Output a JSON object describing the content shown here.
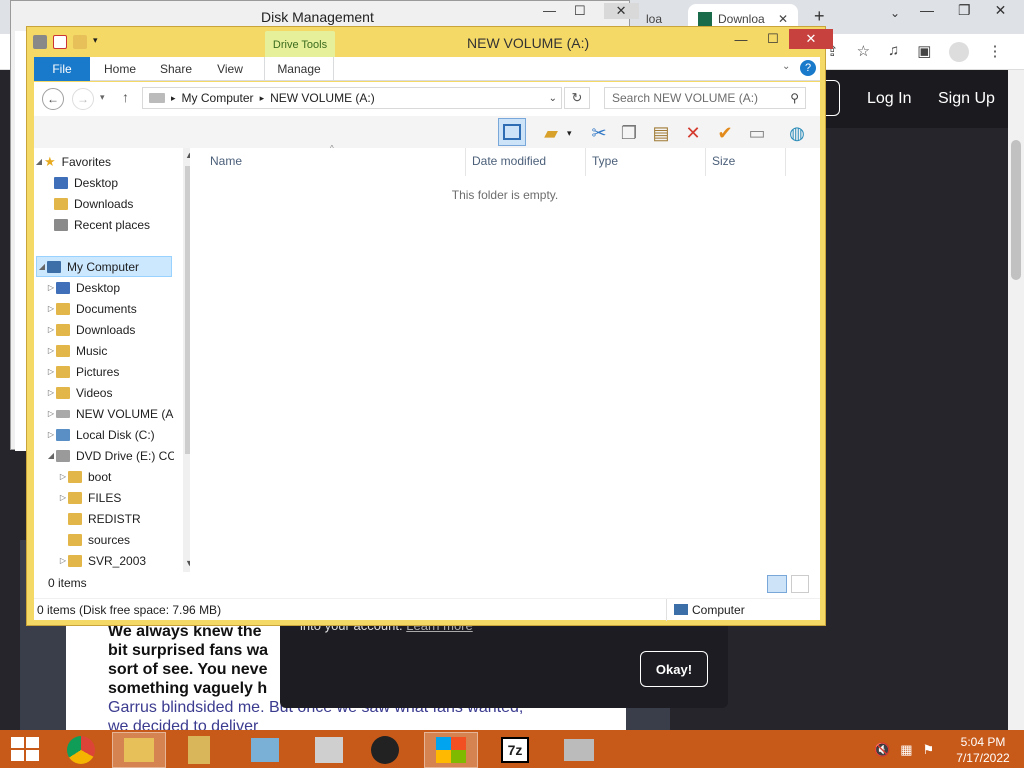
{
  "browser": {
    "tabs": [
      {
        "label": "loa"
      },
      {
        "label": "Downloa"
      }
    ],
    "new_tab": "+",
    "nav": {
      "login": "Log In",
      "signup": "Sign Up"
    },
    "article_lines": [
      "We always knew the",
      "bit surprised fans wa",
      "sort of see. You neve",
      "something vaguely h"
    ],
    "article_blue": "Garrus blindsided me. But once we saw what fans wanted,",
    "article_tail": "we decided to deliver",
    "popup": {
      "text": "into your account.",
      "link": "Learn more",
      "ok": "Okay!"
    }
  },
  "disk_management": {
    "title": "Disk Management"
  },
  "explorer": {
    "title": "NEW VOLUME (A:)",
    "drive_tools": "Drive Tools",
    "ribbon_tabs": [
      "File",
      "Home",
      "Share",
      "View",
      "Manage"
    ],
    "address": {
      "root": "My Computer",
      "current": "NEW VOLUME (A:)"
    },
    "search_placeholder": "Search NEW VOLUME (A:)",
    "tree": {
      "favorites": "Favorites",
      "fav_items": [
        "Desktop",
        "Downloads",
        "Recent places"
      ],
      "computer": "My Computer",
      "computer_items": [
        "Desktop",
        "Documents",
        "Downloads",
        "Music",
        "Pictures",
        "Videos",
        "NEW VOLUME (A:)",
        "Local Disk (C:)",
        "DVD Drive (E:) CC"
      ],
      "dvd_items": [
        "boot",
        "FILES",
        "REDISTR",
        "sources",
        "SVR_2003"
      ]
    },
    "columns": [
      "Name",
      "Date modified",
      "Type",
      "Size"
    ],
    "empty_text": "This folder is empty.",
    "item_count": "0 items",
    "status_text": "0 items (Disk free space: 7.96 MB)",
    "status_location": "Computer"
  },
  "taskbar": {
    "time": "5:04 PM",
    "date": "7/17/2022"
  },
  "colors": {
    "explorer_frame": "#f5d967",
    "file_tab": "#1979ca",
    "taskbar": "#c85a19",
    "close": "#c7423e"
  }
}
